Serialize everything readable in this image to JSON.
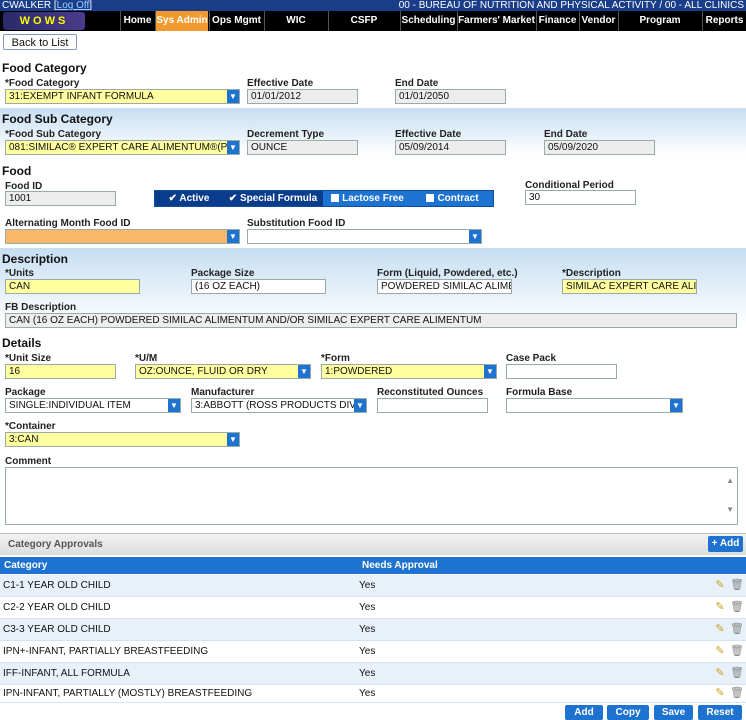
{
  "top": {
    "user": "CWALKER",
    "logoff": "Log Off",
    "agency": "00 - BUREAU OF NUTRITION AND PHYSICAL ACTIVITY / 00 - ALL CLINICS",
    "logo": "WOWS"
  },
  "nav": [
    "Home",
    "Sys Admin",
    "Ops Mgmt",
    "WIC Services",
    "CSFP Services",
    "Scheduling",
    "Farmers' Market",
    "Finance",
    "Vendor",
    "Program Integrity",
    "Reports"
  ],
  "back": "Back to List",
  "food_category": {
    "title": "Food Category",
    "cat_label": "*Food Category",
    "cat_value": "31:EXEMPT INFANT FORMULA",
    "eff_label": "Effective Date",
    "eff_value": "01/01/2012",
    "end_label": "End Date",
    "end_value": "01/01/2050"
  },
  "food_sub": {
    "title": "Food Sub Category",
    "sub_label": "*Food Sub Category",
    "sub_value": "081:SIMILAC® EXPERT CARE ALIMENTUM®(PR",
    "dec_label": "Decrement Type",
    "dec_value": "OUNCE",
    "eff_label": "Effective Date",
    "eff_value": "05/09/2014",
    "end_label": "End Date",
    "end_value": "05/09/2020"
  },
  "food": {
    "title": "Food",
    "id_label": "Food ID",
    "id_value": "1001",
    "toggles": [
      "Active",
      "Special Formula",
      "Lactose Free",
      "Contract"
    ],
    "cond_label": "Conditional Period",
    "cond_value": "30",
    "alt_label": "Alternating Month Food ID",
    "alt_value": "",
    "sub_label": "Substitution Food ID",
    "sub_value": ""
  },
  "description": {
    "title": "Description",
    "units_label": "*Units",
    "units_value": "CAN",
    "pkg_label": "Package Size",
    "pkg_value": "(16 OZ EACH)",
    "form_label": "Form (Liquid, Powdered, etc.)",
    "form_value": "POWDERED SIMILAC ALIME",
    "desc_label": "*Description",
    "desc_value": "SIMILAC EXPERT CARE ALIM",
    "fb_label": "FB Description",
    "fb_value": "CAN (16 OZ EACH) POWDERED SIMILAC ALIMENTUM AND/OR SIMILAC EXPERT CARE ALIMENTUM"
  },
  "details": {
    "title": "Details",
    "unit_label": "*Unit Size",
    "unit_value": "16",
    "um_label": "*U/M",
    "um_value": "OZ:OUNCE, FLUID OR DRY",
    "form_label": "*Form",
    "form_value": "1:POWDERED",
    "case_label": "Case Pack",
    "case_value": "",
    "pkg_label": "Package",
    "pkg_value": "SINGLE:INDIVIDUAL ITEM",
    "mfr_label": "Manufacturer",
    "mfr_value": "3:ABBOTT (ROSS PRODUCTS DIVIS",
    "recon_label": "Reconstituted Ounces",
    "recon_value": "",
    "base_label": "Formula Base",
    "base_value": "",
    "cont_label": "*Container",
    "cont_value": "3:CAN",
    "comment_label": "Comment"
  },
  "approvals": {
    "title": "Category Approvals",
    "add": "+ Add",
    "col1": "Category",
    "col2": "Needs Approval",
    "rows": [
      {
        "cat": "C1-1 YEAR OLD CHILD",
        "needs": "Yes"
      },
      {
        "cat": "C2-2 YEAR OLD CHILD",
        "needs": "Yes"
      },
      {
        "cat": "C3-3 YEAR OLD CHILD",
        "needs": "Yes"
      },
      {
        "cat": "IPN+-INFANT, PARTIALLY BREASTFEEDING",
        "needs": "Yes"
      },
      {
        "cat": "IFF-INFANT, ALL FORMULA",
        "needs": "Yes"
      },
      {
        "cat": "IPN-INFANT, PARTIALLY (MOSTLY) BREASTFEEDING",
        "needs": "Yes"
      }
    ]
  },
  "buttons": [
    "Add",
    "Copy",
    "Save",
    "Reset"
  ]
}
